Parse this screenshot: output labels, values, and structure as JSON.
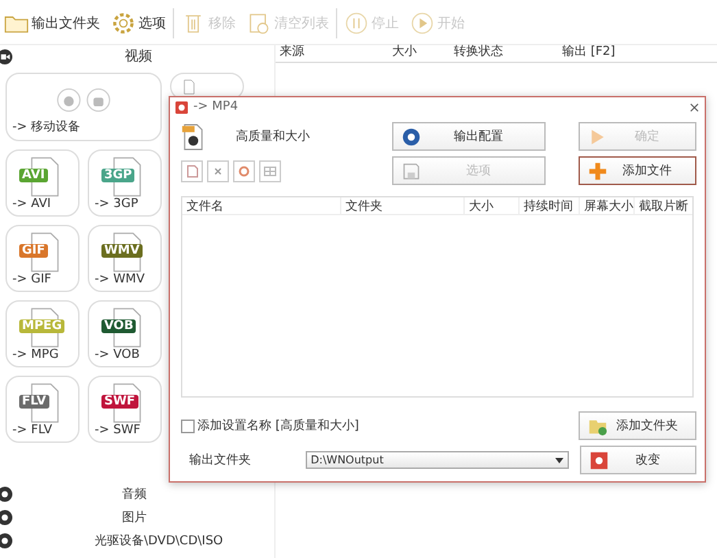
{
  "toolbar": [
    {
      "label": "输出文件夹",
      "disabled": false
    },
    {
      "label": "选项",
      "disabled": false
    },
    {
      "label": "移除",
      "disabled": true
    },
    {
      "label": "清空列表",
      "disabled": true
    },
    {
      "label": "停止",
      "disabled": true
    },
    {
      "label": "开始",
      "disabled": true
    }
  ],
  "sidebar": {
    "category": "视频",
    "big_tile": {
      "label": "-> 移动设备"
    },
    "tiles": [
      {
        "badge": "AVI",
        "label": "-> AVI",
        "color": "#5aa532"
      },
      {
        "badge": "3GP",
        "label": "-> 3GP",
        "color": "#4aa58a"
      },
      {
        "badge": "GIF",
        "label": "-> GIF",
        "color": "#d9762a"
      },
      {
        "badge": "WMV",
        "label": "-> WMV",
        "color": "#6b6e1f"
      },
      {
        "badge": "MPEG",
        "label": "-> MPG",
        "color": "#b8b83a"
      },
      {
        "badge": "VOB",
        "label": "-> VOB",
        "color": "#1f5a32"
      },
      {
        "badge": "FLV",
        "label": "-> FLV",
        "color": "#6b6b6b"
      },
      {
        "badge": "SWF",
        "label": "-> SWF",
        "color": "#c0143c"
      }
    ],
    "more_categories": [
      "音频",
      "图片",
      "光驱设备\\DVD\\CD\\ISO"
    ]
  },
  "list": {
    "columns": [
      "来源",
      "大小",
      "转换状态",
      "输出 [F2]"
    ]
  },
  "dialog": {
    "title": "-> MP4",
    "profile": "高质量和大小",
    "output_config": {
      "label": "输出配置",
      "disabled": false
    },
    "ok": {
      "label": "确定",
      "disabled": true
    },
    "options": {
      "label": "选项",
      "disabled": true
    },
    "add_file": {
      "label": "添加文件",
      "disabled": false
    },
    "columns": [
      "文件名",
      "文件夹",
      "大小",
      "持续时间",
      "屏幕大小",
      "截取片断"
    ],
    "add_setting_name": {
      "label": "添加设置名称 [高质量和大小]",
      "checked": false
    },
    "add_folder": {
      "label": "添加文件夹"
    },
    "output_folder_label": "输出文件夹",
    "output_folder": "D:\\WNOutput",
    "change": {
      "label": "改变"
    }
  }
}
